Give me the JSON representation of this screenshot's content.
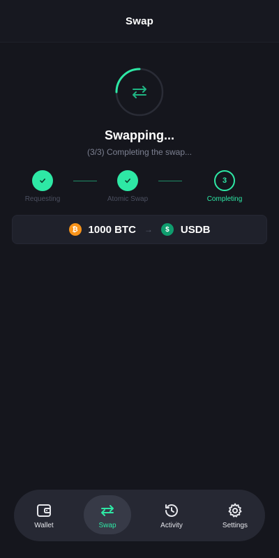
{
  "header": {
    "title": "Swap"
  },
  "status": {
    "title": "Swapping...",
    "subtitle": "(3/3) Completing the swap...",
    "spinner_icon": "swap-arrows-icon"
  },
  "steps": [
    {
      "label": "Requesting",
      "state": "done"
    },
    {
      "label": "Atomic Swap",
      "state": "done"
    },
    {
      "label": "Completing",
      "state": "active",
      "number": "3"
    }
  ],
  "swap_pair": {
    "from_amount": "1000 BTC",
    "from_icon": "bitcoin-icon",
    "arrow_icon": "arrow-right-icon",
    "to_symbol": "USDB",
    "to_icon": "dollar-coin-icon"
  },
  "nav": {
    "items": [
      {
        "label": "Wallet",
        "icon": "wallet-icon"
      },
      {
        "label": "Swap",
        "icon": "swap-icon"
      },
      {
        "label": "Activity",
        "icon": "history-icon"
      },
      {
        "label": "Settings",
        "icon": "gear-icon"
      }
    ],
    "active_label": "Swap"
  },
  "colors": {
    "background": "#15161d",
    "accent": "#2ee8a5",
    "card": "#1f212b",
    "btc": "#f7931a",
    "usdb": "#0f9d6e",
    "muted_text": "#7c8091"
  }
}
